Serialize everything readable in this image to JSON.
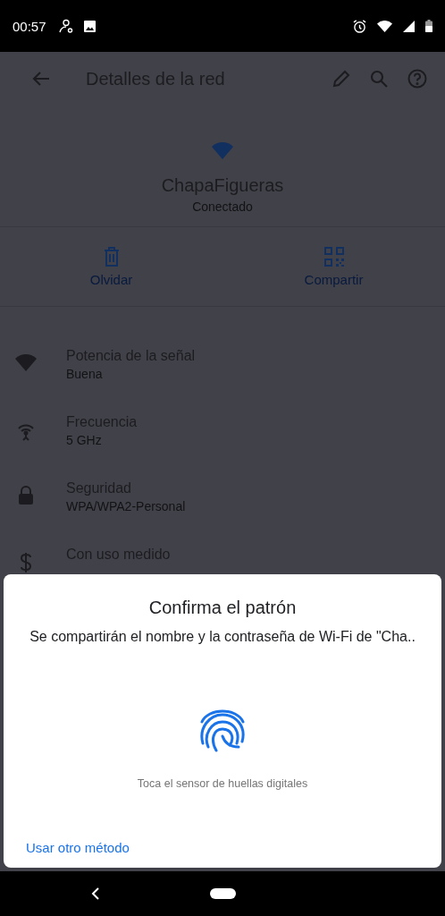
{
  "status_bar": {
    "time": "00:57"
  },
  "app_bar": {
    "title": "Detalles de la red"
  },
  "network": {
    "name": "ChapaFigueras",
    "status": "Conectado"
  },
  "actions": [
    {
      "kind": "forget",
      "label": "Olvidar"
    },
    {
      "kind": "share",
      "label": "Compartir"
    }
  ],
  "details": [
    {
      "kind": "signal",
      "title": "Potencia de la señal",
      "subtitle": "Buena"
    },
    {
      "kind": "frequency",
      "title": "Frecuencia",
      "subtitle": "5 GHz"
    },
    {
      "kind": "security",
      "title": "Seguridad",
      "subtitle": "WPA/WPA2-Personal"
    },
    {
      "kind": "metered",
      "title": "Con uso medido"
    }
  ],
  "dialog": {
    "title": "Confirma el patrón",
    "message": "Se compartirán el nombre y la contraseña de Wi-Fi de \"Cha..",
    "hint": "Toca el sensor de huellas digitales",
    "link": "Usar otro método"
  }
}
